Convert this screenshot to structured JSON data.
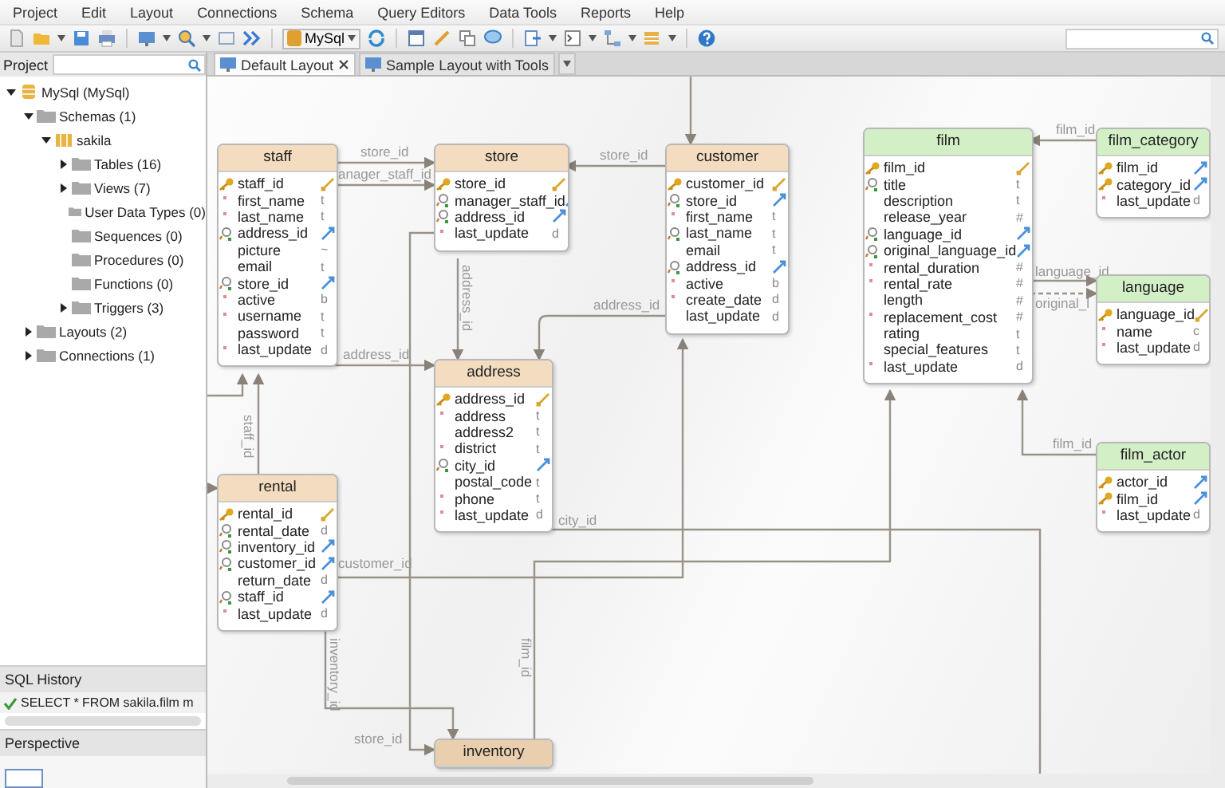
{
  "menu": [
    "Project",
    "Edit",
    "Layout",
    "Connections",
    "Schema",
    "Query Editors",
    "Data Tools",
    "Reports",
    "Help"
  ],
  "toolbar": {
    "connection": "MySql"
  },
  "project_panel": {
    "title": "Project",
    "tree": [
      {
        "label": "MySql (MySql)",
        "kind": "database",
        "expanded": true,
        "children": [
          {
            "label": "Schemas (1)",
            "kind": "folder",
            "expanded": true,
            "children": [
              {
                "label": "sakila",
                "kind": "schema",
                "expanded": true,
                "children": [
                  {
                    "label": "Tables (16)",
                    "kind": "folder",
                    "expanded": false
                  },
                  {
                    "label": "Views (7)",
                    "kind": "folder",
                    "expanded": false
                  },
                  {
                    "label": "User Data Types (0)",
                    "kind": "folder"
                  },
                  {
                    "label": "Sequences (0)",
                    "kind": "folder"
                  },
                  {
                    "label": "Procedures (0)",
                    "kind": "folder"
                  },
                  {
                    "label": "Functions (0)",
                    "kind": "folder"
                  },
                  {
                    "label": "Triggers (3)",
                    "kind": "folder",
                    "expanded": false
                  }
                ]
              }
            ]
          },
          {
            "label": "Layouts (2)",
            "kind": "folder",
            "expanded": false
          },
          {
            "label": "Connections (1)",
            "kind": "folder",
            "expanded": false
          }
        ]
      }
    ]
  },
  "sql_history": {
    "title": "SQL History",
    "entries": [
      {
        "text": "SELECT * FROM sakila.film m",
        "success": true
      }
    ]
  },
  "perspective": {
    "title": "Perspective"
  },
  "tabs": [
    {
      "label": "Default Layout",
      "selected": true,
      "closable": true
    },
    {
      "label": "Sample Layout with Tools",
      "selected": false,
      "closable": false
    }
  ],
  "diagram": {
    "entities": [
      {
        "name": "staff",
        "color": "#f3dcbf",
        "columns": [
          {
            "name": "staff_id",
            "kind": "primary-key"
          },
          {
            "name": "first_name",
            "kind": "required",
            "type": "t"
          },
          {
            "name": "last_name",
            "kind": "required",
            "type": "t"
          },
          {
            "name": "address_id",
            "kind": "foreign-key"
          },
          {
            "name": "picture",
            "kind": "plain",
            "type": "~"
          },
          {
            "name": "email",
            "kind": "plain",
            "type": "t"
          },
          {
            "name": "store_id",
            "kind": "foreign-key"
          },
          {
            "name": "active",
            "kind": "required",
            "type": "b"
          },
          {
            "name": "username",
            "kind": "required",
            "type": "t"
          },
          {
            "name": "password",
            "kind": "plain",
            "type": "t"
          },
          {
            "name": "last_update",
            "kind": "required",
            "type": "d"
          }
        ]
      },
      {
        "name": "store",
        "color": "#f3dcbf",
        "columns": [
          {
            "name": "store_id",
            "kind": "primary-key"
          },
          {
            "name": "manager_staff_id",
            "kind": "foreign-key"
          },
          {
            "name": "address_id",
            "kind": "foreign-key"
          },
          {
            "name": "last_update",
            "kind": "required",
            "type": "d"
          }
        ]
      },
      {
        "name": "customer",
        "color": "#f3dcbf",
        "columns": [
          {
            "name": "customer_id",
            "kind": "primary-key"
          },
          {
            "name": "store_id",
            "kind": "foreign-key"
          },
          {
            "name": "first_name",
            "kind": "required",
            "type": "t"
          },
          {
            "name": "last_name",
            "kind": "index",
            "type": "t"
          },
          {
            "name": "email",
            "kind": "plain",
            "type": "t"
          },
          {
            "name": "address_id",
            "kind": "foreign-key"
          },
          {
            "name": "active",
            "kind": "required",
            "type": "b"
          },
          {
            "name": "create_date",
            "kind": "required",
            "type": "d"
          },
          {
            "name": "last_update",
            "kind": "plain",
            "type": "d"
          }
        ]
      },
      {
        "name": "address",
        "color": "#f3dcbf",
        "columns": [
          {
            "name": "address_id",
            "kind": "primary-key"
          },
          {
            "name": "address",
            "kind": "required",
            "type": "t"
          },
          {
            "name": "address2",
            "kind": "plain",
            "type": "t"
          },
          {
            "name": "district",
            "kind": "required",
            "type": "t"
          },
          {
            "name": "city_id",
            "kind": "foreign-key"
          },
          {
            "name": "postal_code",
            "kind": "plain",
            "type": "t"
          },
          {
            "name": "phone",
            "kind": "required",
            "type": "t"
          },
          {
            "name": "last_update",
            "kind": "required",
            "type": "d"
          }
        ]
      },
      {
        "name": "rental",
        "color": "#f3dcbf",
        "columns": [
          {
            "name": "rental_id",
            "kind": "primary-key"
          },
          {
            "name": "rental_date",
            "kind": "index",
            "type": "d"
          },
          {
            "name": "inventory_id",
            "kind": "foreign-key"
          },
          {
            "name": "customer_id",
            "kind": "foreign-key"
          },
          {
            "name": "return_date",
            "kind": "plain",
            "type": "d"
          },
          {
            "name": "staff_id",
            "kind": "foreign-key"
          },
          {
            "name": "last_update",
            "kind": "required",
            "type": "d"
          }
        ]
      },
      {
        "name": "film",
        "color": "#d3efc6",
        "columns": [
          {
            "name": "film_id",
            "kind": "primary-key"
          },
          {
            "name": "title",
            "kind": "index",
            "type": "t"
          },
          {
            "name": "description",
            "kind": "plain",
            "type": "t"
          },
          {
            "name": "release_year",
            "kind": "plain",
            "type": "#"
          },
          {
            "name": "language_id",
            "kind": "foreign-key"
          },
          {
            "name": "original_language_id",
            "kind": "foreign-key"
          },
          {
            "name": "rental_duration",
            "kind": "required",
            "type": "#"
          },
          {
            "name": "rental_rate",
            "kind": "required",
            "type": "#"
          },
          {
            "name": "length",
            "kind": "plain",
            "type": "#"
          },
          {
            "name": "replacement_cost",
            "kind": "required",
            "type": "#"
          },
          {
            "name": "rating",
            "kind": "plain",
            "type": "t"
          },
          {
            "name": "special_features",
            "kind": "plain",
            "type": "t"
          },
          {
            "name": "last_update",
            "kind": "required",
            "type": "d"
          }
        ]
      },
      {
        "name": "film_category",
        "color": "#d3efc6",
        "columns": [
          {
            "name": "film_id",
            "kind": "key-foreign"
          },
          {
            "name": "category_id",
            "kind": "key-foreign"
          },
          {
            "name": "last_update",
            "kind": "required",
            "type": "d"
          }
        ]
      },
      {
        "name": "language",
        "color": "#d3efc6",
        "columns": [
          {
            "name": "language_id",
            "kind": "primary-key"
          },
          {
            "name": "name",
            "kind": "required",
            "type": "c"
          },
          {
            "name": "last_update",
            "kind": "required",
            "type": "d"
          }
        ]
      },
      {
        "name": "film_actor",
        "color": "#d3efc6",
        "columns": [
          {
            "name": "actor_id",
            "kind": "key-foreign"
          },
          {
            "name": "film_id",
            "kind": "key-foreign"
          },
          {
            "name": "last_update",
            "kind": "required",
            "type": "d"
          }
        ]
      },
      {
        "name": "inventory",
        "color": "#e9cfae"
      }
    ],
    "relations": [
      {
        "label": "store_id"
      },
      {
        "label": "anager_staff_id"
      },
      {
        "label": "store_id"
      },
      {
        "label": "address_id"
      },
      {
        "label": "address_id"
      },
      {
        "label": "address_id"
      },
      {
        "label": "staff_id"
      },
      {
        "label": "customer_id"
      },
      {
        "label": "city_id"
      },
      {
        "label": "film_id"
      },
      {
        "label": "language_id"
      },
      {
        "label": "original_l"
      },
      {
        "label": "film_id"
      },
      {
        "label": "inventory_id"
      },
      {
        "label": "store_id"
      },
      {
        "label": "film_id"
      }
    ]
  }
}
